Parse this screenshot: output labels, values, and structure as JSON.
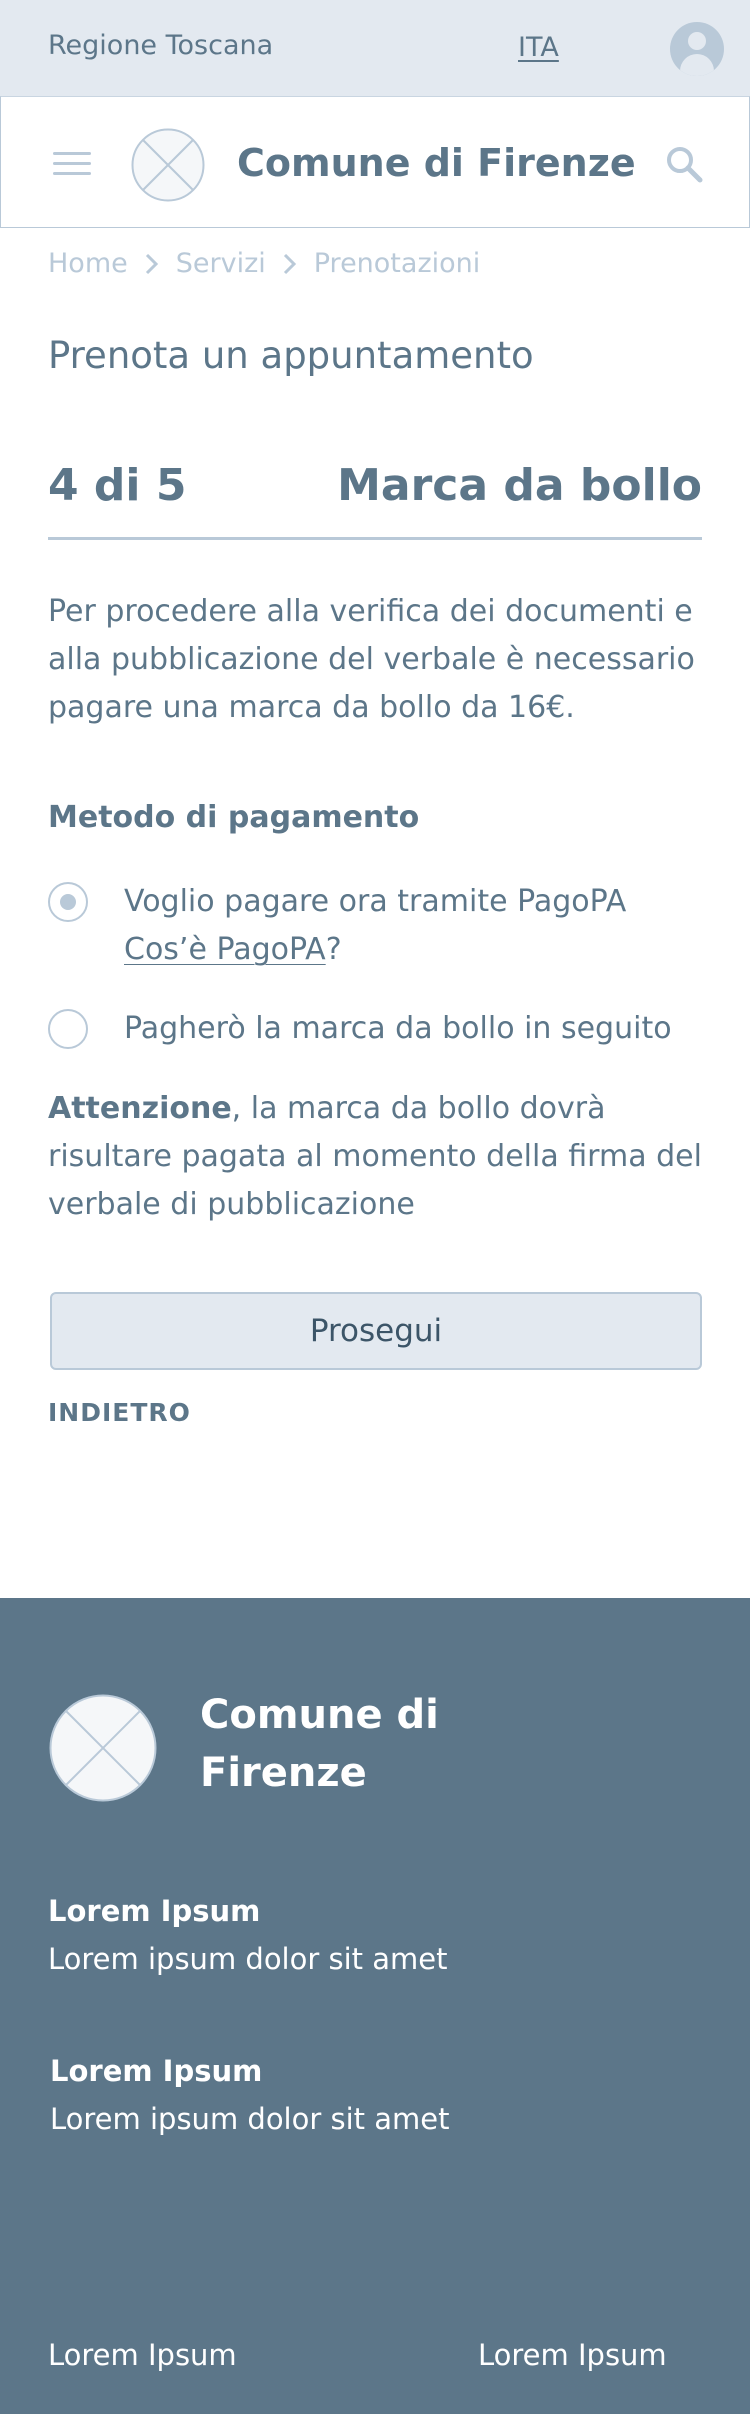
{
  "topbar": {
    "region": "Regione Toscana",
    "language": "ITA"
  },
  "header": {
    "title": "Comune di Firenze"
  },
  "breadcrumb": [
    "Home",
    "Servizi",
    "Prenotazioni"
  ],
  "page_title": "Prenota un appuntamento",
  "step": {
    "number": "4 di 5",
    "name": "Marca da bollo"
  },
  "intro": "Per procedere alla verifica dei documenti e alla pubblicazione del verbale è necessario pagare una marca da bollo da 16€.",
  "payment": {
    "label": "Metodo di pagamento",
    "option_now": "Voglio pagare ora tramite PagoPA",
    "option_now_link": "Cos’è PagoPA",
    "option_now_suffix": "?",
    "option_later": "Pagherò la marca da bollo in seguito",
    "selected": "now"
  },
  "warning": {
    "strong": "Attenzione",
    "text": ", la marca da bollo dovrà risultare pagata al momento della firma del verbale di pubblicazione"
  },
  "actions": {
    "continue": "Prosegui",
    "back": "INDIETRO"
  },
  "footer": {
    "title_line1": "Comune di",
    "title_line2": "Firenze",
    "sections": [
      {
        "title": "Lorem Ipsum",
        "text": "Lorem ipsum dolor sit amet"
      },
      {
        "title": "Lorem Ipsum",
        "text": "Lorem ipsum dolor sit amet"
      }
    ],
    "links": [
      "Lorem Ipsum",
      "Lorem Ipsum"
    ]
  },
  "colors": {
    "primary_text": "#5c7689",
    "light_accent": "#b9c9d8",
    "light_background": "#e3e9f0",
    "footer_background": "#5c7689"
  }
}
